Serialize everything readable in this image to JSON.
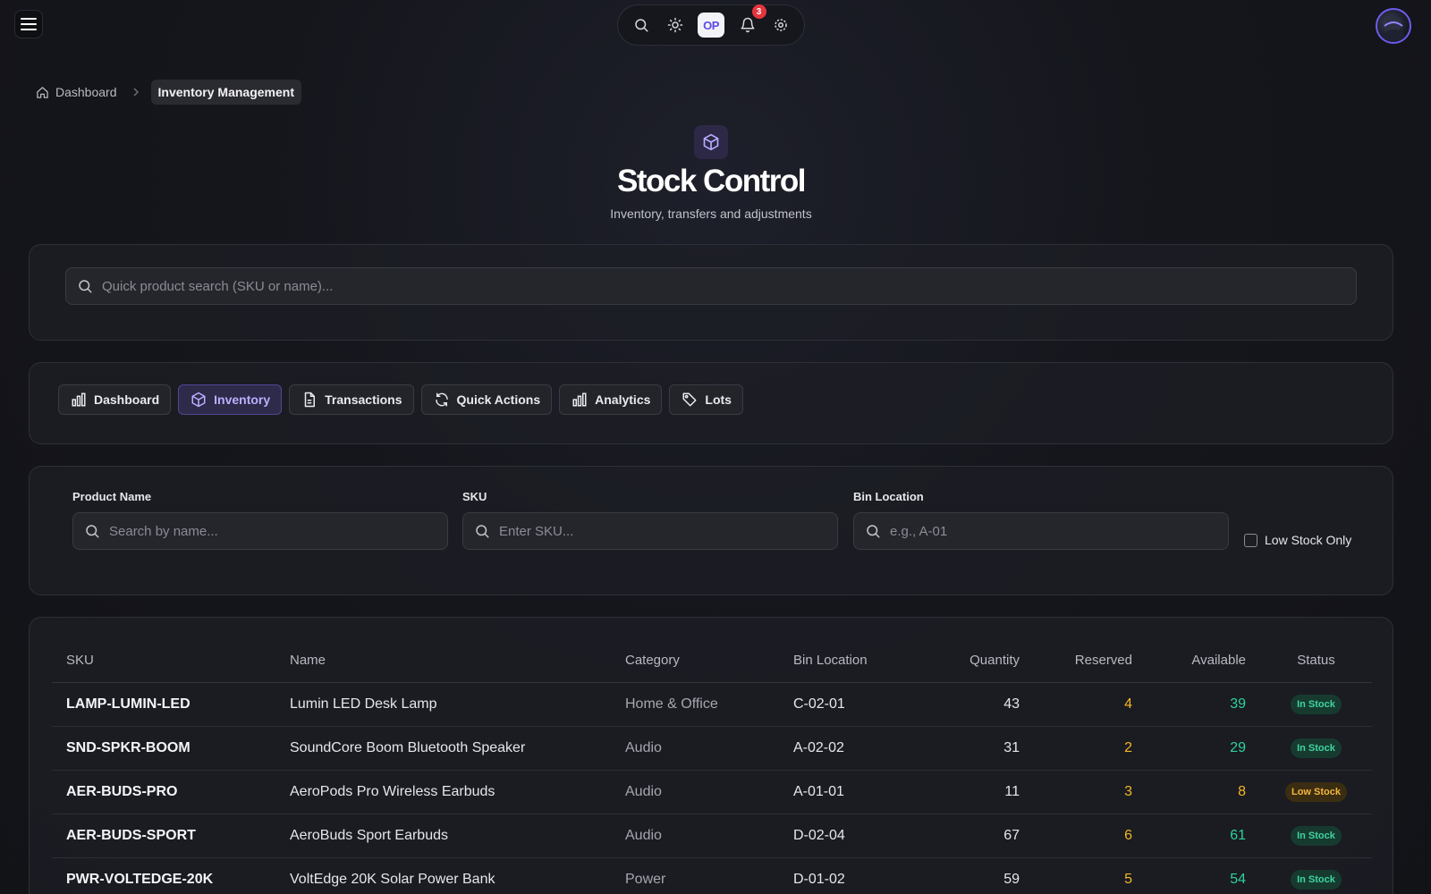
{
  "topbar": {
    "op_label": "OP",
    "notification_count": "3"
  },
  "breadcrumb": {
    "home": "Dashboard",
    "current": "Inventory Management"
  },
  "header": {
    "title": "Stock Control",
    "subtitle": "Inventory, transfers and adjustments"
  },
  "search": {
    "placeholder": "Quick product search (SKU or name)..."
  },
  "tabs": [
    {
      "label": "Dashboard",
      "icon": "bar-chart-icon"
    },
    {
      "label": "Inventory",
      "icon": "box-icon",
      "active": true
    },
    {
      "label": "Transactions",
      "icon": "document-icon"
    },
    {
      "label": "Quick Actions",
      "icon": "refresh-icon"
    },
    {
      "label": "Analytics",
      "icon": "bar-chart-icon"
    },
    {
      "label": "Lots",
      "icon": "tag-icon"
    }
  ],
  "filters": {
    "product_name": {
      "label": "Product Name",
      "placeholder": "Search by name..."
    },
    "sku": {
      "label": "SKU",
      "placeholder": "Enter SKU..."
    },
    "bin": {
      "label": "Bin Location",
      "placeholder": "e.g., A-01"
    },
    "low_stock_label": "Low Stock Only"
  },
  "table": {
    "headers": {
      "sku": "SKU",
      "name": "Name",
      "category": "Category",
      "bin": "Bin Location",
      "quantity": "Quantity",
      "reserved": "Reserved",
      "available": "Available",
      "status": "Status"
    },
    "rows": [
      {
        "sku": "LAMP-LUMIN-LED",
        "name": "Lumin LED Desk Lamp",
        "category": "Home & Office",
        "bin": "C-02-01",
        "quantity": "43",
        "reserved": "4",
        "available": "39",
        "status": "In Stock"
      },
      {
        "sku": "SND-SPKR-BOOM",
        "name": "SoundCore Boom Bluetooth Speaker",
        "category": "Audio",
        "bin": "A-02-02",
        "quantity": "31",
        "reserved": "2",
        "available": "29",
        "status": "In Stock"
      },
      {
        "sku": "AER-BUDS-PRO",
        "name": "AeroPods Pro Wireless Earbuds",
        "category": "Audio",
        "bin": "A-01-01",
        "quantity": "11",
        "reserved": "3",
        "available": "8",
        "status": "Low Stock"
      },
      {
        "sku": "AER-BUDS-SPORT",
        "name": "AeroBuds Sport Earbuds",
        "category": "Audio",
        "bin": "D-02-04",
        "quantity": "67",
        "reserved": "6",
        "available": "61",
        "status": "In Stock"
      },
      {
        "sku": "PWR-VOLTEDGE-20K",
        "name": "VoltEdge 20K Solar Power Bank",
        "category": "Power",
        "bin": "D-01-02",
        "quantity": "59",
        "reserved": "5",
        "available": "54",
        "status": "In Stock"
      }
    ]
  },
  "colors": {
    "accent": "#7b6cf6",
    "in_stock": "#2fd19a",
    "low_stock": "#f5b622",
    "notification": "#e5353c"
  }
}
